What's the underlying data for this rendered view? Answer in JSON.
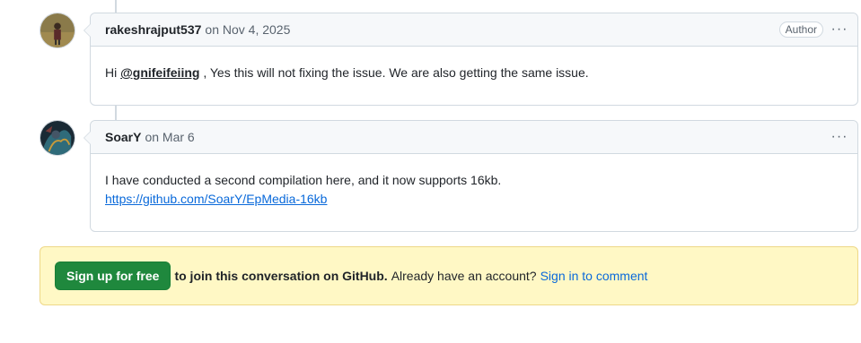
{
  "comments": [
    {
      "author": "rakeshrajput537",
      "timestamp": "on Nov 4, 2025",
      "badge": "Author",
      "more": "···",
      "body": {
        "prefix": "Hi ",
        "mention": "@gnifeifeiing",
        "suffix": " , Yes this will not fixing the issue. We are also getting the same issue."
      }
    },
    {
      "author": "SoarY",
      "timestamp": "on Mar 6",
      "more": "···",
      "body": {
        "text": "I have conducted a second compilation here, and it now supports 16kb.",
        "link": "https://github.com/SoarY/EpMedia-16kb"
      }
    }
  ],
  "signup": {
    "button_label": "Sign up for free",
    "join_text": "to join this conversation on GitHub.",
    "have_account": "Already have an account?",
    "signin_link": "Sign in to comment"
  },
  "colors": {
    "primary_button": "#1f883d",
    "link": "#0969da",
    "banner_bg": "#fff8c5"
  }
}
